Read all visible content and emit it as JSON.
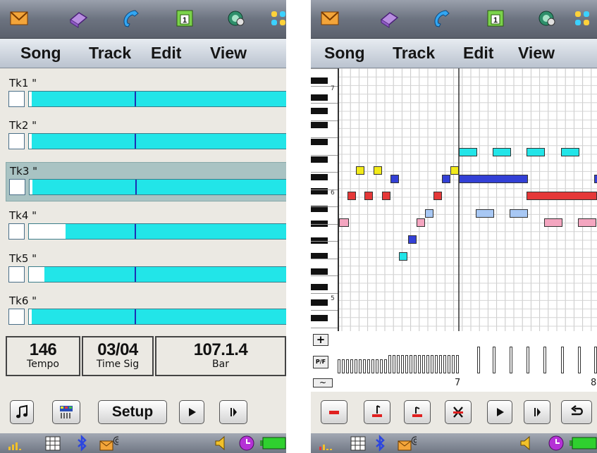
{
  "menu": [
    "Song",
    "Track",
    "Edit",
    "View"
  ],
  "top_icons": [
    "mail-icon",
    "book-icon",
    "phone-icon",
    "calendar-icon",
    "globe-icon",
    "apps-grid-icon"
  ],
  "status_icons": [
    "signal-icon",
    "keypad-icon",
    "bluetooth-icon",
    "message-icon",
    "volume-icon",
    "clock-icon",
    "battery-icon"
  ],
  "song_screen": {
    "tracks": [
      {
        "label": "Tk1 \"",
        "level": 0.01,
        "selected": false
      },
      {
        "label": "Tk2 \"",
        "level": 0.01,
        "selected": false
      },
      {
        "label": "Tk3 \"",
        "level": 0.01,
        "selected": true
      },
      {
        "label": "Tk4 \"",
        "level": 0.14,
        "selected": false
      },
      {
        "label": "Tk5 \"",
        "level": 0.06,
        "selected": false
      },
      {
        "label": "Tk6 \"",
        "level": 0.01,
        "selected": false
      }
    ],
    "tempo": {
      "value": "146",
      "label": "Tempo"
    },
    "time_sig": {
      "value": "03/04",
      "label": "Time Sig"
    },
    "bar": {
      "value": "107.1.4",
      "label": "Bar"
    },
    "toolbar": {
      "setup_label": "Setup"
    }
  },
  "piano_screen": {
    "bar_numbers": [
      "7",
      "8"
    ],
    "octave_labels": [
      "7",
      "6",
      "5"
    ],
    "side_buttons": [
      "+",
      "P/F",
      "~"
    ]
  },
  "colors": {
    "track_bar": "#22e5e8",
    "note_cyan": "#22e5e8",
    "note_yellow": "#f2ea1a",
    "note_blue": "#3340d6",
    "note_red": "#e53838",
    "note_lightblue": "#a8c8f4",
    "note_pink": "#f4a6c0"
  }
}
